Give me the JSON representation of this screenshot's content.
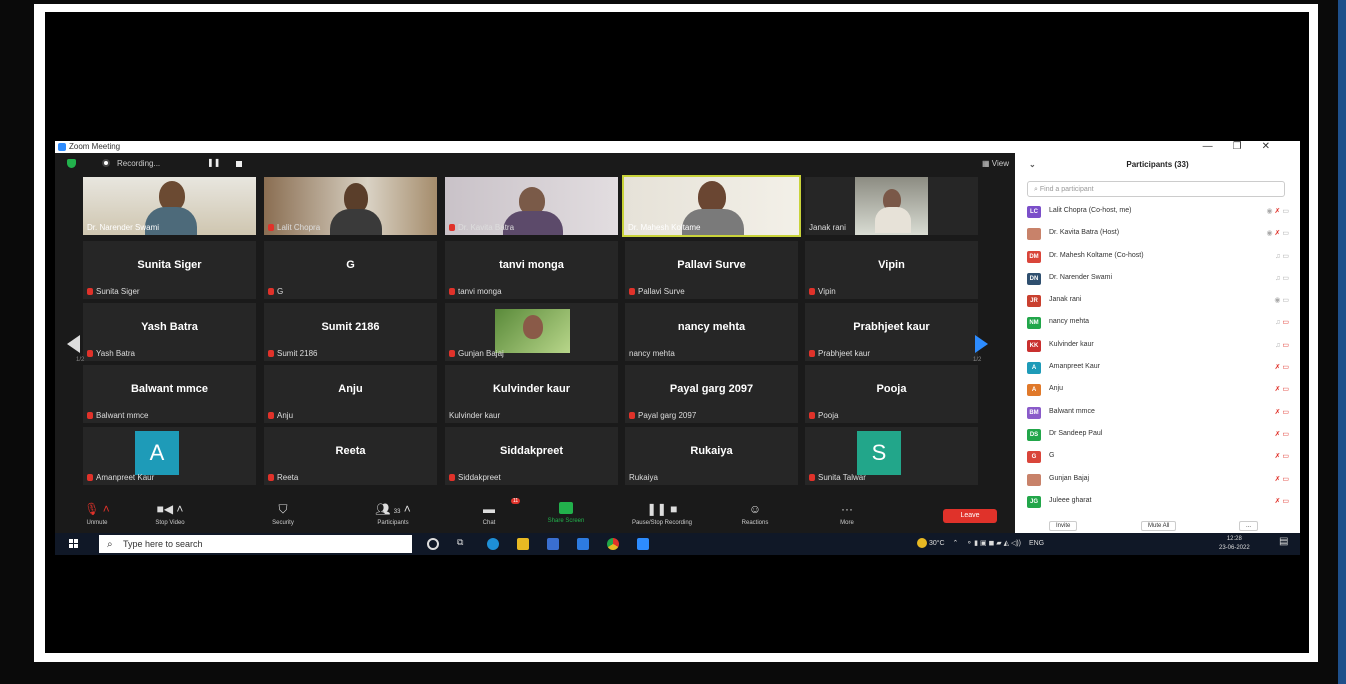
{
  "window": {
    "title": "Zoom Meeting",
    "controls": [
      "—",
      "❐",
      "✕"
    ]
  },
  "topbar": {
    "recording_label": "Recording...",
    "view_label": "View"
  },
  "tiles": [
    {
      "name": "Dr. Narender Swami",
      "label": "Dr. Narender Swami",
      "type": "video"
    },
    {
      "name": "Lalit Chopra",
      "label": "Lalit Chopra",
      "type": "video"
    },
    {
      "name": "Dr. Kavita Batra",
      "label": "Dr. Kavita Batra",
      "type": "video"
    },
    {
      "name": "Dr. Mahesh Koltame",
      "label": "Dr. Mahesh Koltame",
      "type": "video"
    },
    {
      "name": "Janak rani",
      "label": "Janak rani",
      "type": "video"
    },
    {
      "name": "Sunita Siger",
      "label": "Sunita Siger",
      "type": "name"
    },
    {
      "name": "G",
      "label": "G",
      "type": "name"
    },
    {
      "name": "tanvi monga",
      "label": "tanvi monga",
      "type": "name"
    },
    {
      "name": "Pallavi Surve",
      "label": "Pallavi Surve",
      "type": "name"
    },
    {
      "name": "Vipin",
      "label": "Vipin",
      "type": "name"
    },
    {
      "name": "Yash Batra",
      "label": "Yash Batra",
      "type": "name"
    },
    {
      "name": "Sumit 2186",
      "label": "Sumit 2186",
      "type": "name"
    },
    {
      "name": "Gunjan Bajaj",
      "label": "Gunjan Bajaj",
      "type": "photo"
    },
    {
      "name": "nancy mehta",
      "label": "nancy mehta",
      "type": "name"
    },
    {
      "name": "Prabhjeet kaur",
      "label": "Prabhjeet kaur",
      "type": "name"
    },
    {
      "name": "Balwant mmce",
      "label": "Balwant mmce",
      "type": "name"
    },
    {
      "name": "Anju",
      "label": "Anju",
      "type": "name"
    },
    {
      "name": "Kulvinder kaur",
      "label": "Kulvinder kaur",
      "type": "name"
    },
    {
      "name": "Payal garg 2097",
      "label": "Payal garg 2097",
      "type": "name"
    },
    {
      "name": "Pooja",
      "label": "Pooja",
      "type": "name"
    },
    {
      "name": "A",
      "label": "Amanpreet Kaur",
      "type": "avatar"
    },
    {
      "name": "Reeta",
      "label": "Reeta",
      "type": "name"
    },
    {
      "name": "Siddakpreet",
      "label": "Siddakpreet",
      "type": "name"
    },
    {
      "name": "Rukaiya",
      "label": "Rukaiya",
      "type": "name"
    },
    {
      "name": "S",
      "label": "Sunita Talwar",
      "type": "avatar"
    }
  ],
  "pager": {
    "left": "1/2",
    "right": "1/2"
  },
  "toolbar": {
    "unmute": "Unmute",
    "stop_video": "Stop Video",
    "security": "Security",
    "participants": "Participants",
    "participants_count": "33",
    "chat": "Chat",
    "chat_badge": "11",
    "share": "Share Screen",
    "recording": "Pause/Stop Recording",
    "reactions": "Reactions",
    "more": "More",
    "leave": "Leave"
  },
  "participants_panel": {
    "title": "Participants (33)",
    "search_placeholder": "Find a participant",
    "items": [
      {
        "initials": "LC",
        "name": "Lalit Chopra (Co-host, me)",
        "color": "#7b4fc9"
      },
      {
        "initials": "",
        "name": "Dr. Kavita Batra (Host)",
        "color": "#c8826a"
      },
      {
        "initials": "DM",
        "name": "Dr. Mahesh Koltame (Co-host)",
        "color": "#d9453a"
      },
      {
        "initials": "DN",
        "name": "Dr. Narender Swami",
        "color": "#2f4f6f"
      },
      {
        "initials": "JR",
        "name": "Janak rani",
        "color": "#c9402f"
      },
      {
        "initials": "NM",
        "name": "nancy mehta",
        "color": "#22a64a"
      },
      {
        "initials": "KK",
        "name": "Kulvinder kaur",
        "color": "#c9302f"
      },
      {
        "initials": "A",
        "name": "Amanpreet Kaur",
        "color": "#1e9bb8"
      },
      {
        "initials": "A",
        "name": "Anju",
        "color": "#e0792a"
      },
      {
        "initials": "BM",
        "name": "Balwant mmce",
        "color": "#8a5bc9"
      },
      {
        "initials": "DS",
        "name": "Dr Sandeep Paul",
        "color": "#22a64a"
      },
      {
        "initials": "G",
        "name": "G",
        "color": "#d9453a"
      },
      {
        "initials": "",
        "name": "Gunjan Bajaj",
        "color": "#c8826a"
      },
      {
        "initials": "JG",
        "name": "Juleee gharat",
        "color": "#22a64a"
      }
    ],
    "invite": "Invite",
    "mute_all": "Mute All",
    "more": "..."
  },
  "taskbar": {
    "search_placeholder": "Type here to search",
    "temperature": "30°C",
    "language": "ENG",
    "time": "12:28",
    "date": "23-06-2022"
  },
  "colors": {
    "accent": "#2d8cff",
    "leave": "#e0322a",
    "share": "#22b14c",
    "frame": "#1e4f8a"
  }
}
